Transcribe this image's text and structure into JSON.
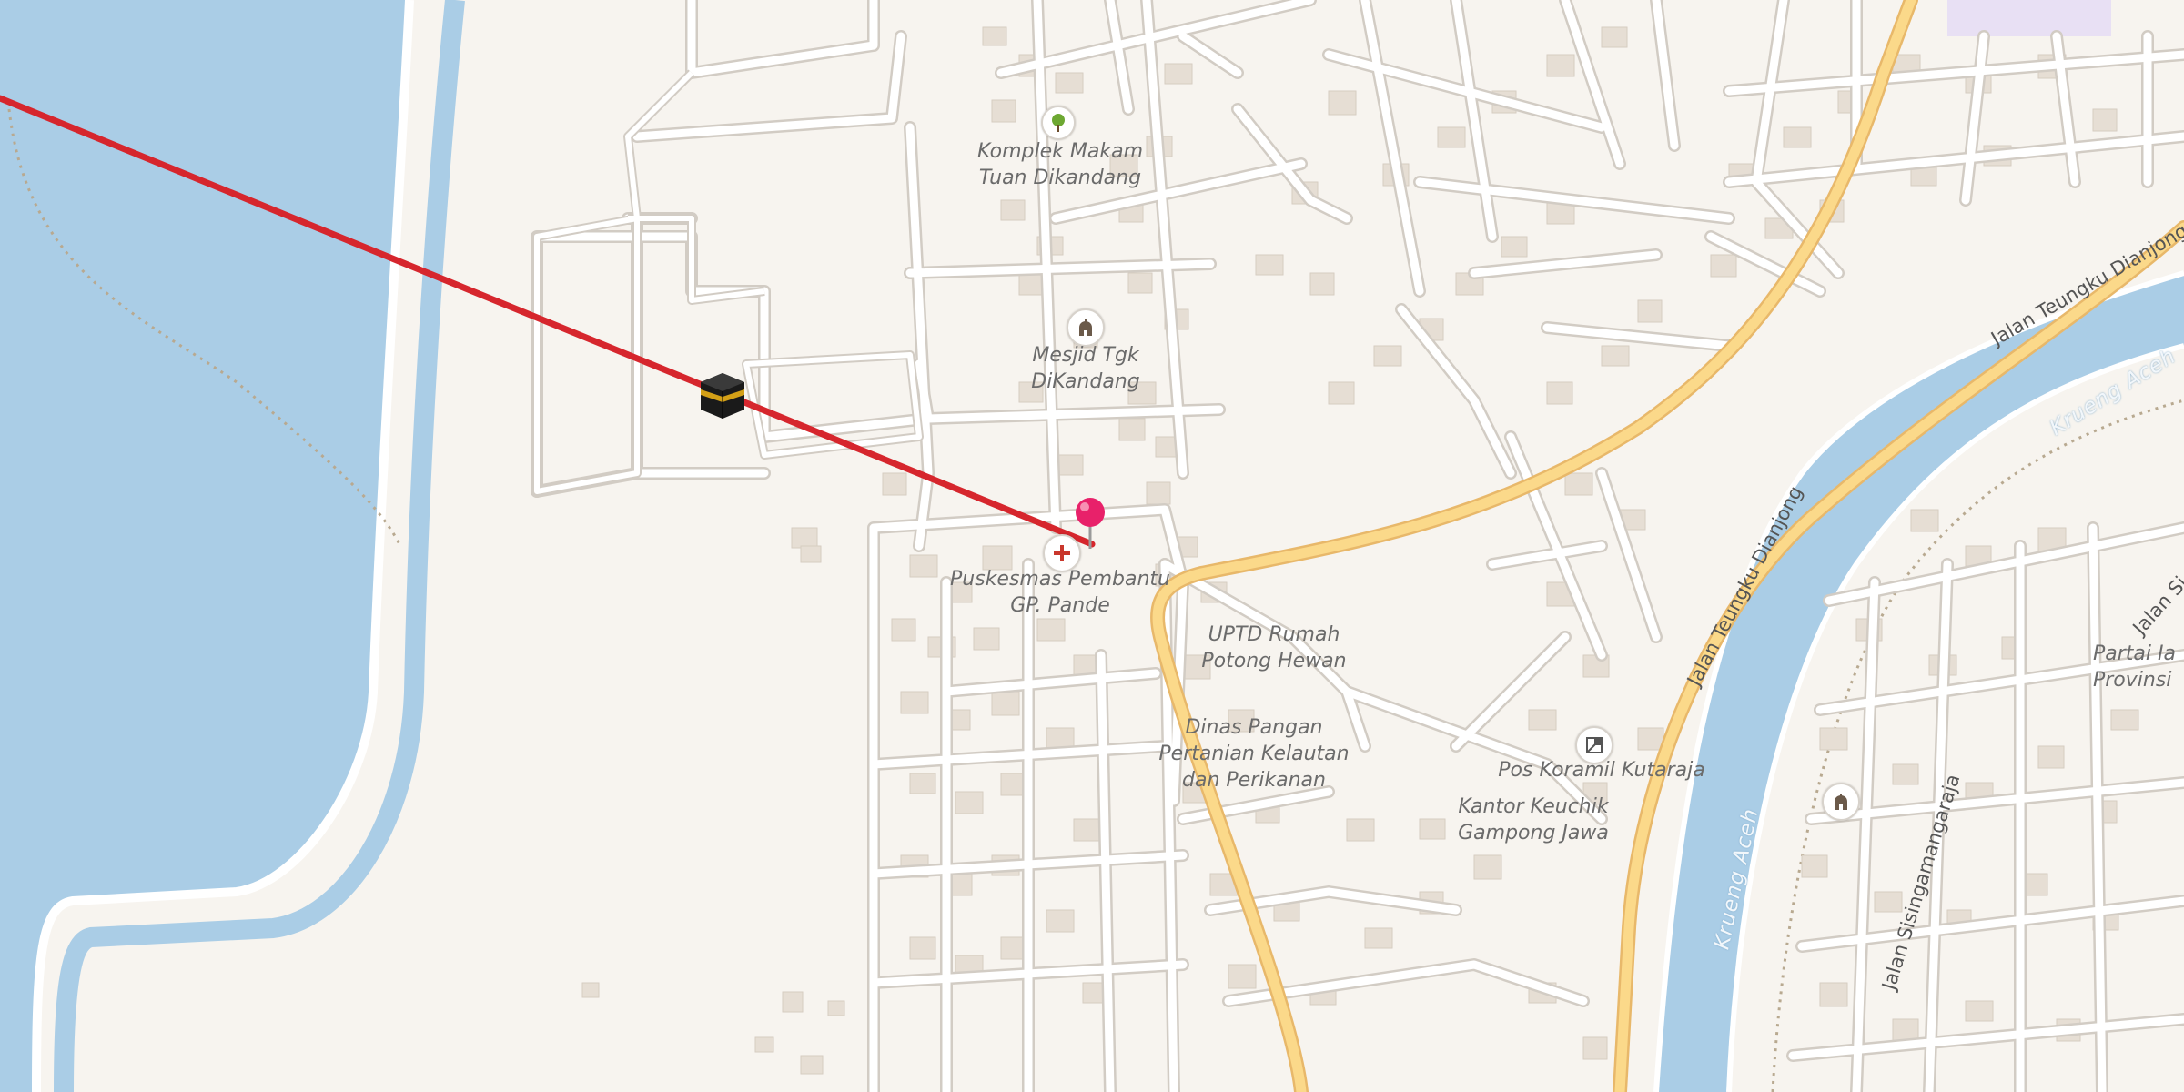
{
  "map": {
    "background_color": "#f7f4ef",
    "water_color": "#aacde6",
    "road_major_color": "#fbd98a",
    "building_color": "#e6ded4",
    "qibla_line_color": "#d6262d"
  },
  "labels": {
    "komplek_makam": [
      "Komplek Makam",
      "Tuan Dikandang"
    ],
    "mesjid": [
      "Mesjid Tgk",
      "DiKandang"
    ],
    "puskesmas": [
      "Puskesmas Pembantu",
      "GP. Pande"
    ],
    "uptd": [
      "UPTD Rumah",
      "Potong Hewan"
    ],
    "dinas": [
      "Dinas Pangan",
      "Pertanian Kelautan",
      "dan Perikanan"
    ],
    "pos_koramil": "Pos Koramil Kutaraja",
    "kantor_keuchik": [
      "Kantor Keuchik",
      "Gampong Jawa"
    ],
    "partai": [
      "Partai Ia",
      "Provinsi"
    ]
  },
  "roads": {
    "teungku_dianjong_1": "Jalan Teungku Dianjong",
    "teungku_dianjong_2": "Jalan Teungku Dianjong",
    "sisingamangaraja": "Jalan Sisingamangaraja",
    "jalan_si": "Jalan Si"
  },
  "waterways": {
    "krueng_aceh_1": "Krueng Aceh",
    "krueng_aceh_2": "Krueng Aceh"
  },
  "icons": {
    "kaaba": "kaaba-icon",
    "pin": "location-pin-icon",
    "cemetery": "tree-icon",
    "mosque": "mosque-icon",
    "clinic": "medical-cross-icon",
    "military": "military-post-icon"
  }
}
